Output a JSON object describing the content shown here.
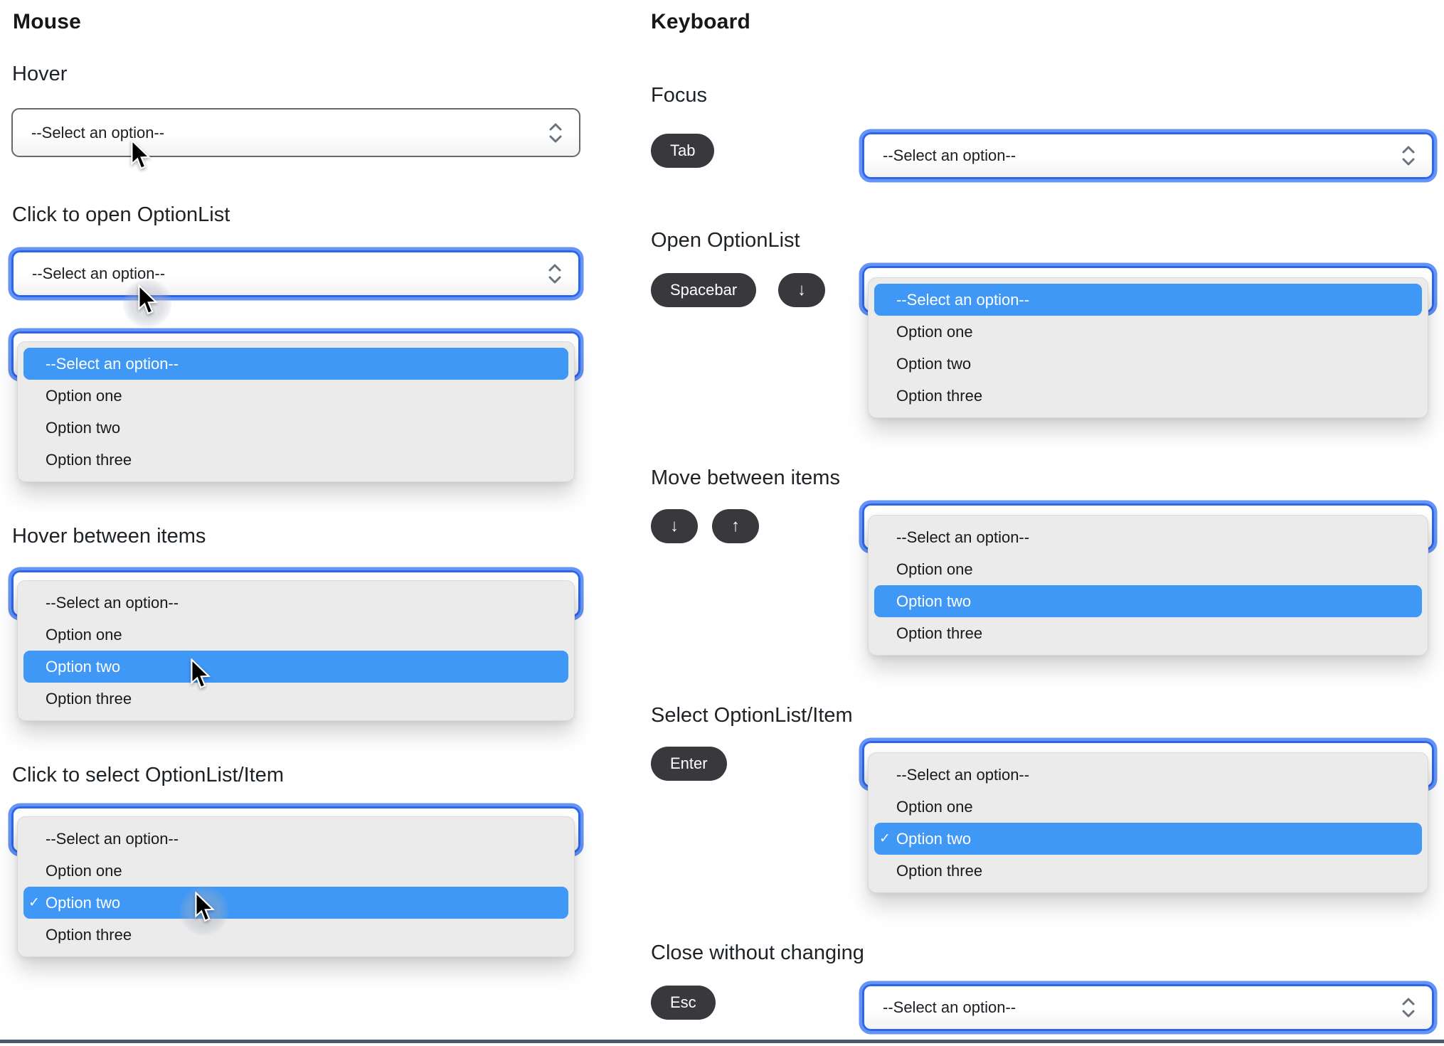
{
  "mouse": {
    "title": "Mouse",
    "hover_label": "Hover",
    "open_label": "Click to open OptionList",
    "between_label": "Hover between items",
    "select_label": "Click to select OptionList/Item"
  },
  "keyboard": {
    "title": "Keyboard",
    "focus_label": "Focus",
    "open_label": "Open OptionList",
    "move_label": "Move between items",
    "select_label": "Select OptionList/Item",
    "close_label": "Close without changing",
    "keys": {
      "tab": "Tab",
      "spacebar": "Spacebar",
      "down": "↓",
      "up": "↑",
      "enter": "Enter",
      "esc": "Esc"
    }
  },
  "optionlist": {
    "placeholder": "--Select an option--",
    "options": [
      "--Select an option--",
      "Option one",
      "Option two",
      "Option three"
    ],
    "selected_mark": "✓"
  },
  "colors": {
    "highlight": "#3f97f6",
    "focus_ring": "#6494f6",
    "focus_border": "#2d65ec",
    "plain_border": "#67676f",
    "popup_bg": "#ebebec",
    "key_bg": "#38383d",
    "divider": "#4b5a6a"
  }
}
